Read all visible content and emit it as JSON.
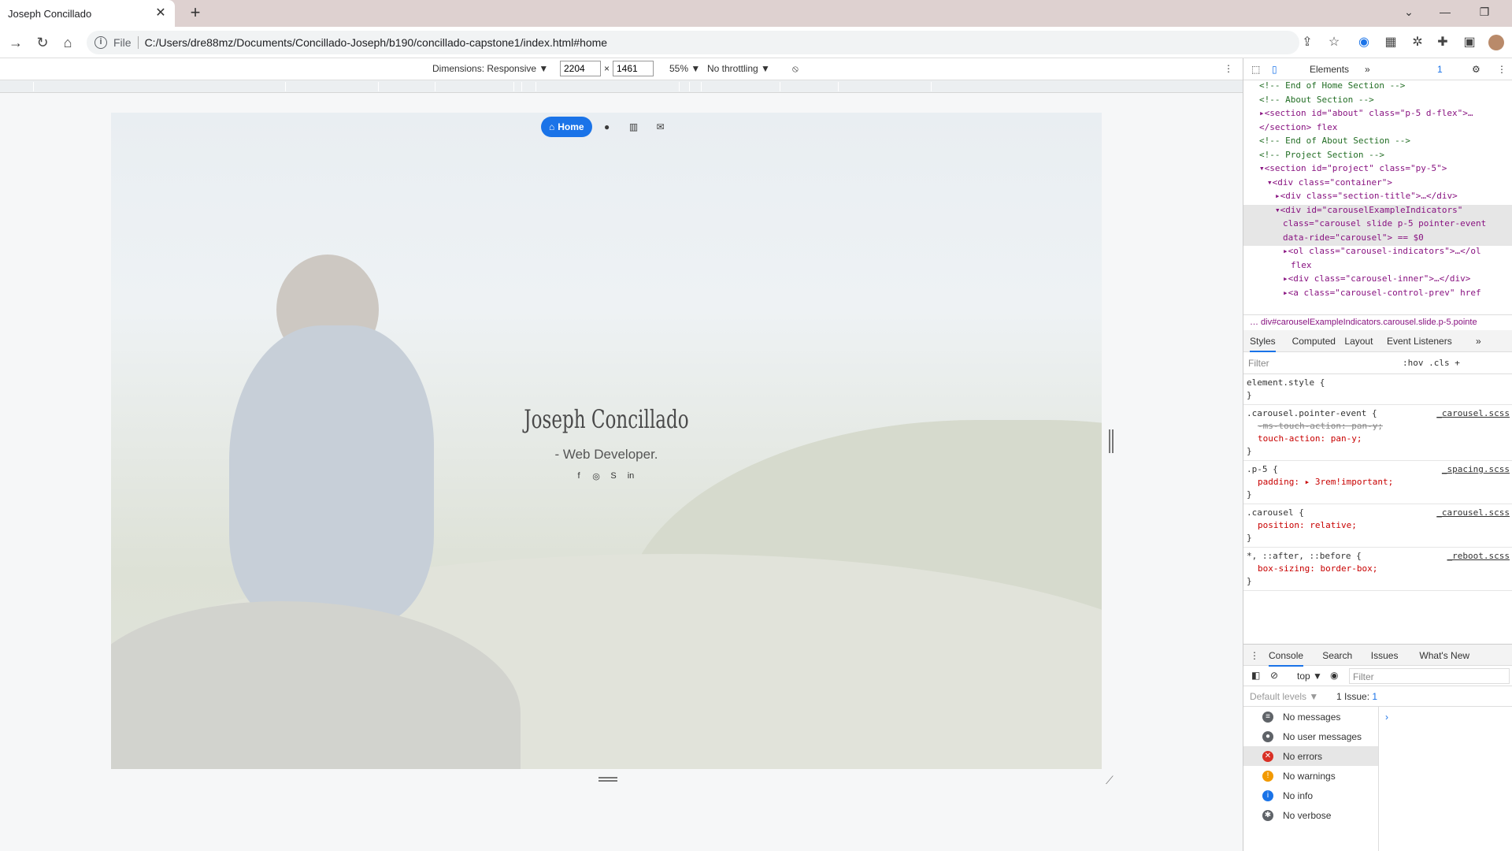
{
  "browser": {
    "tab_title": "Joseph Concillado",
    "tab_close": "✕",
    "new_tab": "+",
    "url_scheme": "File",
    "url": "C:/Users/dre88mz/Documents/Concillado-Joseph/b190/concillado-capstone1/index.html#home"
  },
  "device_toolbar": {
    "dimensions_label": "Dimensions: Responsive ▼",
    "width": "2204",
    "times": "×",
    "height": "1461",
    "zoom": "55% ▼",
    "throttling": "No throttling ▼"
  },
  "page": {
    "nav_home": "Home",
    "hero_name": "Joseph Concillado",
    "hero_role": "- Web Developer."
  },
  "devtools": {
    "top_tab": "Elements",
    "issues_badge": "1",
    "dom_lines": [
      {
        "type": "comment",
        "text": "<!-- End of Home Section -->",
        "indent": 2
      },
      {
        "type": "comment",
        "text": "<!-- About Section -->",
        "indent": 2
      },
      {
        "type": "node",
        "text": "▸<section id=\"about\" class=\"p-5 d-flex\">…",
        "indent": 2
      },
      {
        "type": "node",
        "text": "</section> flex",
        "indent": 2
      },
      {
        "type": "comment",
        "text": "<!-- End of About Section -->",
        "indent": 2
      },
      {
        "type": "comment",
        "text": "<!-- Project Section -->",
        "indent": 2
      },
      {
        "type": "node",
        "text": "▾<section id=\"project\" class=\"py-5\">",
        "indent": 2
      },
      {
        "type": "node",
        "text": "▾<div class=\"container\">",
        "indent": 3
      },
      {
        "type": "node",
        "text": "▸<div class=\"section-title\">…</div>",
        "indent": 4
      },
      {
        "type": "node",
        "text": "▾<div id=\"carouselExampleIndicators\"",
        "indent": 4,
        "selected": true
      },
      {
        "type": "node",
        "text": "class=\"carousel slide p-5 pointer-event",
        "indent": 5,
        "selected": true
      },
      {
        "type": "node",
        "text": "data-ride=\"carousel\"> == $0",
        "indent": 5,
        "selected": true
      },
      {
        "type": "node",
        "text": "▸<ol class=\"carousel-indicators\">…</ol",
        "indent": 5
      },
      {
        "type": "node",
        "text": "flex",
        "indent": 6
      },
      {
        "type": "node",
        "text": "▸<div class=\"carousel-inner\">…</div>",
        "indent": 5
      },
      {
        "type": "node",
        "text": "▸<a class=\"carousel-control-prev\" href",
        "indent": 5
      }
    ],
    "breadcrumb": "…   div#carouselExampleIndicators.carousel.slide.p-5.pointe",
    "panel_tabs": [
      "Styles",
      "Computed",
      "Layout",
      "Event Listeners",
      "»"
    ],
    "filter_placeholder": "Filter",
    "filter_tools": ":hov  .cls  +",
    "rules": [
      {
        "selector": "element.style {",
        "src": "",
        "props": [],
        "close": "}"
      },
      {
        "selector": ".carousel.pointer-event {",
        "src": "_carousel.scss",
        "props": [
          {
            "text": "-ms-touch-action: pan-y;",
            "strike": true
          },
          {
            "text": "touch-action: pan-y;",
            "strike": false
          }
        ],
        "close": "}"
      },
      {
        "selector": ".p-5 {",
        "src": "_spacing.scss",
        "props": [
          {
            "text": "padding: ▸ 3rem!important;",
            "strike": false
          }
        ],
        "close": "}"
      },
      {
        "selector": ".carousel {",
        "src": "_carousel.scss",
        "props": [
          {
            "text": "position: relative;",
            "strike": false
          }
        ],
        "close": "}"
      },
      {
        "selector": "*, ::after, ::before {",
        "src": "_reboot.scss",
        "props": [
          {
            "text": "box-sizing: border-box;",
            "strike": false
          }
        ],
        "close": "}"
      }
    ],
    "console_tabs": [
      "Console",
      "Search",
      "Issues",
      "What's New"
    ],
    "context": "top ▼",
    "console_filter": "Filter",
    "default_levels": "Default levels ▼",
    "issue_count": "1 Issue: ",
    "issue_badge": "1",
    "sidebar_items": [
      {
        "label": "No messages",
        "icon": "list-icon",
        "color": "#5f6368"
      },
      {
        "label": "No user messages",
        "icon": "user-icon",
        "color": "#5f6368"
      },
      {
        "label": "No errors",
        "icon": "error-icon",
        "color": "#d93025",
        "active": true
      },
      {
        "label": "No warnings",
        "icon": "warning-icon",
        "color": "#f29900"
      },
      {
        "label": "No info",
        "icon": "info-icon",
        "color": "#1a73e8"
      },
      {
        "label": "No verbose",
        "icon": "bug-icon",
        "color": "#5f6368"
      }
    ]
  }
}
